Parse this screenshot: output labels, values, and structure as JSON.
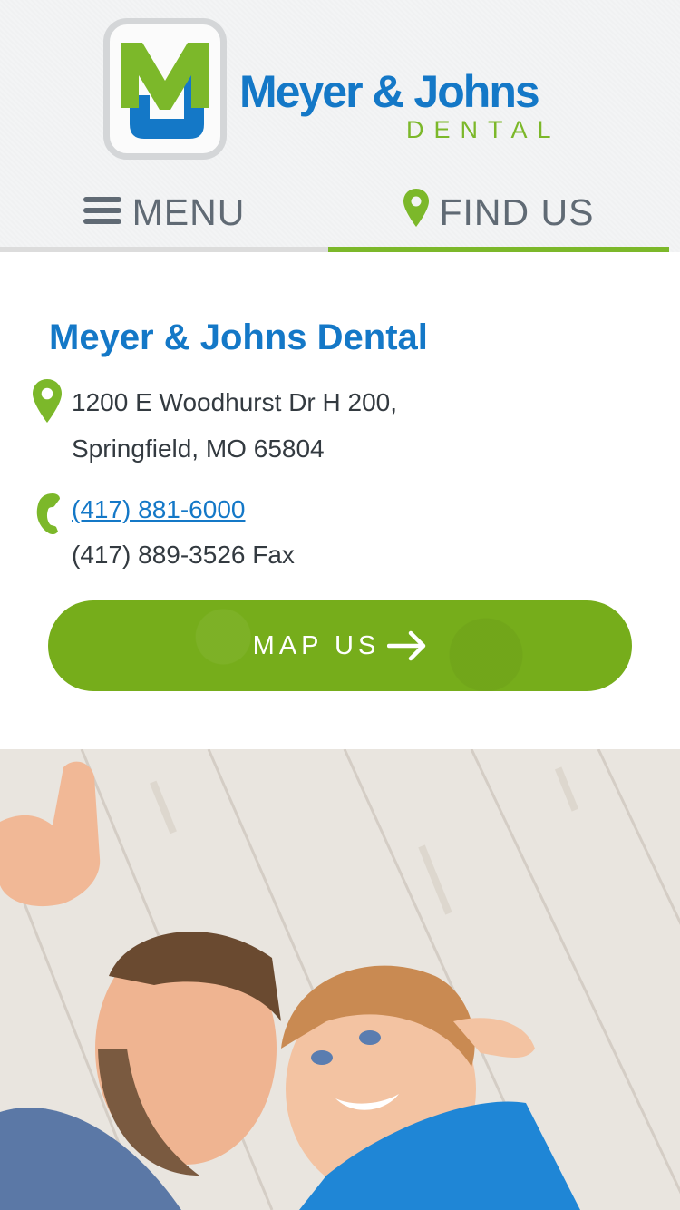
{
  "brand": {
    "name": "Meyer & Johns",
    "subtitle": "DENTAL",
    "colors": {
      "blue": "#1478c7",
      "green": "#7cb82a",
      "gray": "#606a74"
    }
  },
  "nav": {
    "menu_label": "MENU",
    "menu_icon": "hamburger-icon",
    "find_label": "FIND US",
    "find_icon": "map-pin-icon",
    "active": "FIND US"
  },
  "location": {
    "name": "Meyer & Johns Dental",
    "address_line1": "1200 E Woodhurst Dr H 200,",
    "address_line2": "Springfield, MO 65804",
    "phone": "(417) 881-6000",
    "fax": "(417) 889-3526 Fax",
    "map_button": "MAP US",
    "map_button_icon": "arrow-right-icon"
  },
  "hero": {
    "image": "father-and-son-lying-on-wooden-floor-photo"
  }
}
